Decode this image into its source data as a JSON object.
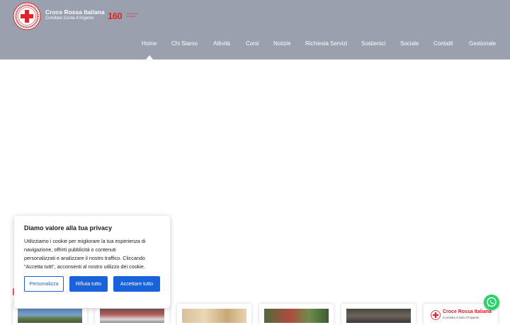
{
  "header": {
    "brand_title": "Croce Rossa Italiana",
    "brand_subtitle": "Comitato Costa d'Argento",
    "anniversary_number": "160",
    "anniversary_text": "Insieme per l'umanità",
    "background_color": "#9aa0ad"
  },
  "nav": {
    "items": [
      {
        "label": "Home",
        "active": true
      },
      {
        "label": "Chi Siamo"
      },
      {
        "label": "Attività"
      },
      {
        "label": "Corsi"
      },
      {
        "label": "Notizie"
      },
      {
        "label": "Richiesta Servizi"
      },
      {
        "label": "Sostienici"
      },
      {
        "label": "Sociale"
      },
      {
        "label": "Contatti"
      },
      {
        "label": "Gestionale"
      }
    ]
  },
  "cookie_banner": {
    "title": "Diamo valore alla tua privacy",
    "text_lines": [
      "Utilizziamo i cookie per migliorare la tua esperienza di",
      "navigazione, offrirti pubblicità o contenuti",
      "personalizzati e analizzare il nostro traffico. Cliccando",
      "\"Accetta tutti\", acconsenti al nostro utilizzo dei cookie."
    ],
    "customize_label": "Personalizza",
    "reject_label": "Rifiuta tutto",
    "accept_label": "Accettare tutto",
    "accent_color": "#1863dc"
  },
  "section": {
    "heading_visible": "P"
  },
  "cards": {
    "last_card_title": "Croce Rossa Italiana",
    "last_card_subtitle": "Comitato Costa d'Argento"
  },
  "icons": [
    "cri-logo-icon",
    "whatsapp-icon"
  ],
  "colors": {
    "red": "#e2232a",
    "whatsapp": "#25d366"
  }
}
